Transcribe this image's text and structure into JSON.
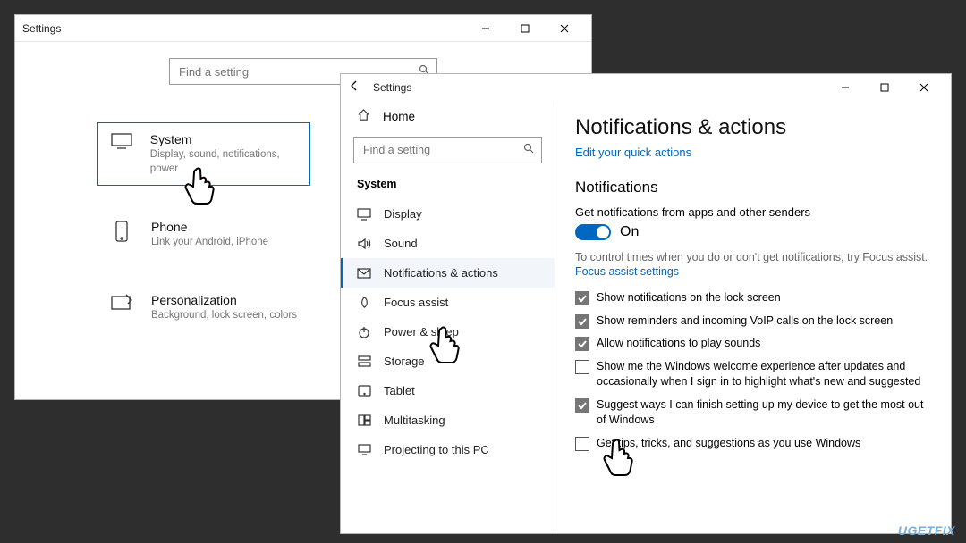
{
  "main_window": {
    "title": "Settings",
    "search_placeholder": "Find a setting",
    "tiles": [
      {
        "title": "System",
        "sub": "Display, sound, notifications, power"
      },
      {
        "title": "Phone",
        "sub": "Link your Android, iPhone"
      },
      {
        "title": "Personalization",
        "sub": "Background, lock screen, colors"
      }
    ]
  },
  "sys_window": {
    "title": "Settings",
    "home_label": "Home",
    "search_placeholder": "Find a setting",
    "group_label": "System",
    "nav": [
      "Display",
      "Sound",
      "Notifications & actions",
      "Focus assist",
      "Power & sleep",
      "Storage",
      "Tablet",
      "Multitasking",
      "Projecting to this PC"
    ],
    "page_title": "Notifications & actions",
    "page_subtitle": "Edit your quick actions",
    "section_notifications": "Notifications",
    "get_notifications_label": "Get notifications from apps and other senders",
    "on_label": "On",
    "hint_text": "To control times when you do or don't get notifications, try Focus assist.",
    "focus_link": "Focus assist settings",
    "checks": [
      {
        "checked": true,
        "label": "Show notifications on the lock screen"
      },
      {
        "checked": true,
        "label": "Show reminders and incoming VoIP calls on the lock screen"
      },
      {
        "checked": true,
        "label": "Allow notifications to play sounds"
      },
      {
        "checked": false,
        "label": "Show me the Windows welcome experience after updates and occasionally when I sign in to highlight what's new and suggested"
      },
      {
        "checked": true,
        "label": "Suggest ways I can finish setting up my device to get the most out of Windows"
      },
      {
        "checked": false,
        "label": "Get tips, tricks, and suggestions as you use Windows"
      }
    ]
  },
  "watermark": "UGETFIX"
}
